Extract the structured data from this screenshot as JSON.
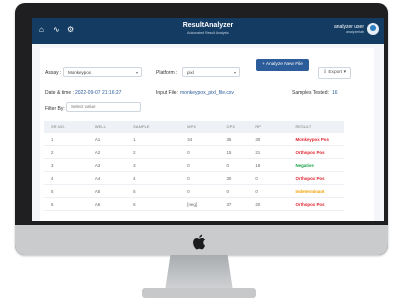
{
  "app": {
    "title": "ResultAnalyzer",
    "subtitle": "Automated Result Analysis"
  },
  "user": {
    "name": "analyzer user",
    "role": "analyzerlab"
  },
  "toolbar": {
    "assay_label": "Assay :",
    "assay_value": "Monkeypox",
    "platform_label": "Platform :",
    "platform_value": "pixl",
    "analyze_button": "+ Analyze New File",
    "export_button": "Export"
  },
  "meta": {
    "date_label": "Date & time :",
    "date_value": "2022-09-07 21:16:27",
    "input_label": "Input File:",
    "input_value": "monkeypox_pixl_file.csv",
    "samples_label": "Samples Tested:",
    "samples_value": "16"
  },
  "filter": {
    "label": "Filter By:",
    "placeholder": "Select value"
  },
  "table": {
    "headers": [
      "SR.NO.",
      "WELL",
      "SAMPLE",
      "MPX",
      "OPX",
      "RP",
      "RESULT"
    ],
    "rows": [
      {
        "sr": "1",
        "well": "A1",
        "sample": "1",
        "mpx": "34",
        "opx": "35",
        "rp": "30",
        "result": "Monkeypox Pos",
        "tone": "red"
      },
      {
        "sr": "2",
        "well": "A2",
        "sample": "2",
        "mpx": "0",
        "opx": "15",
        "rp": "21",
        "result": "Orthopox Pos",
        "tone": "red"
      },
      {
        "sr": "3",
        "well": "A3",
        "sample": "3",
        "mpx": "0",
        "opx": "0",
        "rp": "18",
        "result": "Negative",
        "tone": "green"
      },
      {
        "sr": "4",
        "well": "A4",
        "sample": "4",
        "mpx": "0",
        "opx": "30",
        "rp": "0",
        "result": "Orthopox Pos",
        "tone": "red"
      },
      {
        "sr": "5",
        "well": "A5",
        "sample": "5",
        "mpx": "0",
        "opx": "0",
        "rp": "0",
        "result": "Indeterminant",
        "tone": "amber"
      },
      {
        "sr": "6",
        "well": "A6",
        "sample": "6",
        "mpx": "[neg]",
        "opx": "37",
        "rp": "20",
        "result": "Orthopox Pos",
        "tone": "red"
      }
    ]
  },
  "colors": {
    "topbar": "#143c63",
    "accent": "#2c5c99",
    "positive": "#e0242e",
    "negative": "#17a044",
    "indeterminate": "#f0a100"
  }
}
